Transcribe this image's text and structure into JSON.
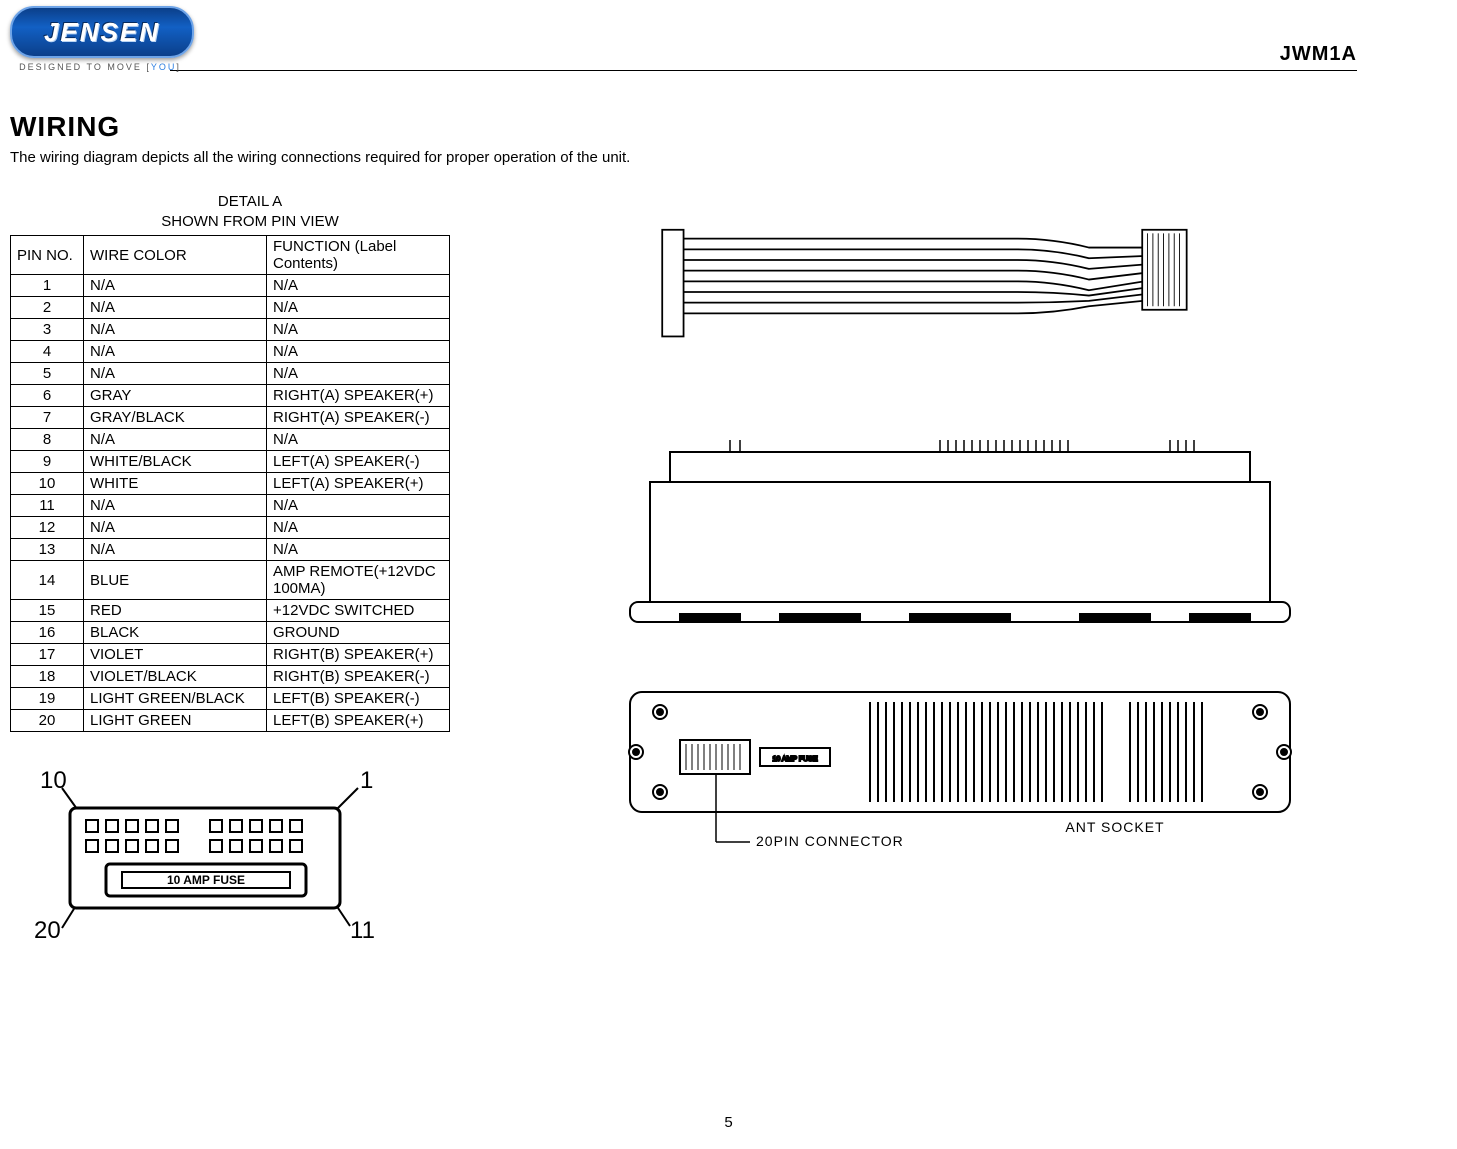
{
  "header": {
    "brand": "JENSEN",
    "tagline_pre": "DESIGNED TO MOVE [",
    "tagline_you": "YOU",
    "tagline_post": "]",
    "model": "JWM1A"
  },
  "section_title": "WIRING",
  "intro": "The wiring diagram depicts all the wiring connections required for proper operation of the unit.",
  "table": {
    "caption_line1": "DETAIL A",
    "caption_line2": "SHOWN FROM PIN VIEW",
    "headers": [
      "PIN NO.",
      "WIRE COLOR",
      "FUNCTION (Label Contents)"
    ],
    "rows": [
      {
        "pin": "1",
        "color": "N/A",
        "func": "N/A"
      },
      {
        "pin": "2",
        "color": "N/A",
        "func": "N/A"
      },
      {
        "pin": "3",
        "color": "N/A",
        "func": "N/A"
      },
      {
        "pin": "4",
        "color": "N/A",
        "func": "N/A"
      },
      {
        "pin": "5",
        "color": "N/A",
        "func": "N/A"
      },
      {
        "pin": "6",
        "color": "GRAY",
        "func": "RIGHT(A) SPEAKER(+)"
      },
      {
        "pin": "7",
        "color": "GRAY/BLACK",
        "func": "RIGHT(A) SPEAKER(-)"
      },
      {
        "pin": "8",
        "color": "N/A",
        "func": "N/A"
      },
      {
        "pin": "9",
        "color": "WHITE/BLACK",
        "func": "LEFT(A) SPEAKER(-)"
      },
      {
        "pin": "10",
        "color": "WHITE",
        "func": "LEFT(A) SPEAKER(+)"
      },
      {
        "pin": "11",
        "color": "N/A",
        "func": "N/A"
      },
      {
        "pin": "12",
        "color": "N/A",
        "func": "N/A"
      },
      {
        "pin": "13",
        "color": "N/A",
        "func": "N/A"
      },
      {
        "pin": "14",
        "color": "BLUE",
        "func": "AMP REMOTE(+12VDC 100MA)"
      },
      {
        "pin": "15",
        "color": "RED",
        "func": "+12VDC SWITCHED"
      },
      {
        "pin": "16",
        "color": "BLACK",
        "func": "GROUND"
      },
      {
        "pin": "17",
        "color": "VIOLET",
        "func": "RIGHT(B) SPEAKER(+)"
      },
      {
        "pin": "18",
        "color": "VIOLET/BLACK",
        "func": "RIGHT(B) SPEAKER(-)"
      },
      {
        "pin": "19",
        "color": "LIGHT GREEN/BLACK",
        "func": "LEFT(B) SPEAKER(-)"
      },
      {
        "pin": "20",
        "color": "LIGHT GREEN",
        "func": "LEFT(B) SPEAKER(+)"
      }
    ]
  },
  "connector_figure": {
    "label_tl": "10",
    "label_tr": "1",
    "label_bl": "20",
    "label_br": "11",
    "fuse_label": "10 AMP FUSE"
  },
  "rear_figure": {
    "connector_label": "20PIN CONNECTOR",
    "antenna_label": "ANT SOCKET",
    "fuse_label": "10 AMP FUSE"
  },
  "page_number": "5"
}
